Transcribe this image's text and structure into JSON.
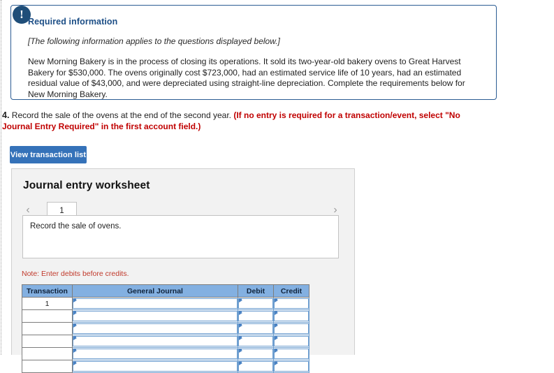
{
  "callout": {
    "badge_icon": "exclamation-icon",
    "title": "Required information",
    "italic_note": "[The following information applies to the questions displayed below.]",
    "body": "New Morning Bakery is in the process of closing its operations. It sold its two-year-old bakery ovens to Great Harvest Bakery for $530,000. The ovens originally cost $723,000, had an estimated service life of 10 years, had an estimated residual value of $43,000, and were depreciated using straight-line depreciation. Complete the requirements below for New Morning Bakery."
  },
  "question": {
    "number": "4.",
    "text": "Record the sale of the ovens at the end of the second year.",
    "red_instruction": "(If no entry is required for a transaction/event, select \"No Journal Entry Required\" in the first account field.)"
  },
  "toolbar": {
    "view_transaction_list_label": "View transaction list"
  },
  "worksheet": {
    "title": "Journal entry worksheet",
    "prev_arrow": "‹",
    "next_arrow": "›",
    "tabs": [
      {
        "label": "1",
        "active": true
      }
    ],
    "description": "Record the sale of ovens.",
    "note": "Note: Enter debits before credits.",
    "table": {
      "headers": [
        "Transaction",
        "General Journal",
        "Debit",
        "Credit"
      ],
      "rows": [
        {
          "transaction": "1",
          "general_journal": "",
          "debit": "",
          "credit": ""
        },
        {
          "transaction": "",
          "general_journal": "",
          "debit": "",
          "credit": ""
        },
        {
          "transaction": "",
          "general_journal": "",
          "debit": "",
          "credit": ""
        },
        {
          "transaction": "",
          "general_journal": "",
          "debit": "",
          "credit": ""
        },
        {
          "transaction": "",
          "general_journal": "",
          "debit": "",
          "credit": ""
        },
        {
          "transaction": "",
          "general_journal": "",
          "debit": "",
          "credit": ""
        }
      ]
    }
  },
  "colors": {
    "accent_blue": "#3572b9",
    "callout_border": "#2b5c93",
    "badge": "#1f4e79",
    "table_header": "#83b0e1",
    "note_red": "#c0392b",
    "instruction_red": "#c00000",
    "panel_bg": "#f2f2f2"
  }
}
